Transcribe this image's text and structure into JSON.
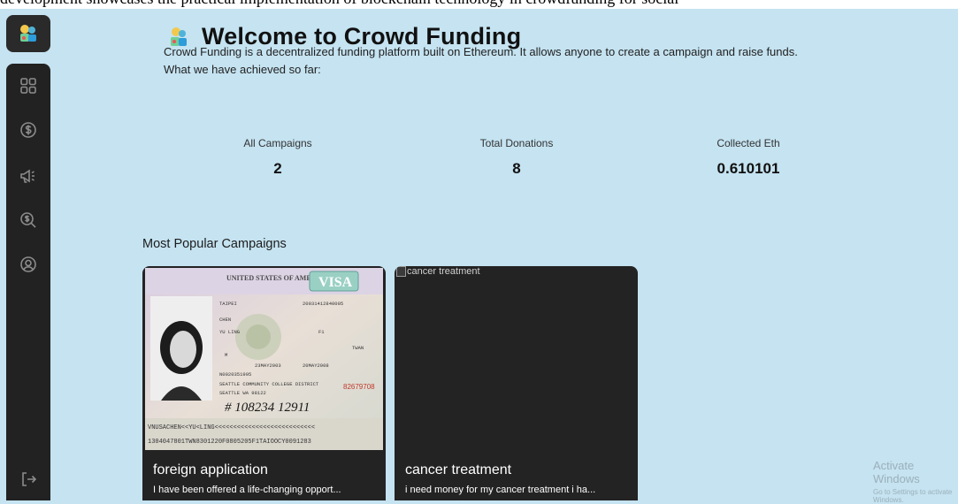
{
  "caption": "development showcases the practical implementation of blockchain technology in crowdfunding for social",
  "header": {
    "title": "Welcome to Crowd Funding",
    "intro": "Crowd Funding is a decentralized funding platform built on Ethereum. It allows anyone to create a campaign and raise funds.",
    "achieved": "What we have achieved so far:"
  },
  "sidebar": {
    "logo_icon": "crowd-logo-icon",
    "items": [
      {
        "icon": "dashboard-grid-icon"
      },
      {
        "icon": "dollar-coin-icon"
      },
      {
        "icon": "megaphone-icon"
      },
      {
        "icon": "search-dollar-icon"
      },
      {
        "icon": "profile-icon"
      }
    ],
    "logout_icon": "logout-icon"
  },
  "stats": [
    {
      "label": "All Campaigns",
      "value": "2"
    },
    {
      "label": "Total Donations",
      "value": "8"
    },
    {
      "label": "Collected Eth",
      "value": "0.610101"
    }
  ],
  "popular": {
    "title": "Most Popular Campaigns",
    "campaigns": [
      {
        "title": "foreign application",
        "description": "I have been offered a life-changing opport...",
        "image_kind": "visa document photo"
      },
      {
        "title": "cancer treatment",
        "description": "i need money for my cancer treatment i ha...",
        "image_alt": "cancer treatment"
      }
    ]
  },
  "visa": {
    "header": "UNITED STATES OF AMERICA",
    "stamp": "VISA",
    "place": "TAIPEI",
    "control": "20031412840005",
    "surname": "CHEN",
    "given": "YU LING",
    "visa_class": "F1",
    "sex": "M",
    "nationality": "TWAN",
    "issue": "23MAY2003",
    "expiry": "20MAY2008",
    "annotation_1": "N0020351995",
    "annotation_2": "SEATTLE COMMUNITY COLLEGE DISTRICT",
    "annotation_3": "SEATTLE WA 98122",
    "serial": "82679708",
    "handwriting": "# 108234 12911",
    "mrz_1": "VNUSACHEN<<YU<LING<<<<<<<<<<<<<<<<<<<<<<<<<<<",
    "mrz_2": "1304047801TWN8301220F0805205F1TAIOOCY0091283"
  },
  "watermark": {
    "title": "Activate Windows",
    "subtitle": "Go to Settings to activate Windows."
  },
  "colors": {
    "background": "#c5e3f1",
    "sidebar": "#222222",
    "card": "#232323",
    "icon": "#8c8c8c"
  }
}
